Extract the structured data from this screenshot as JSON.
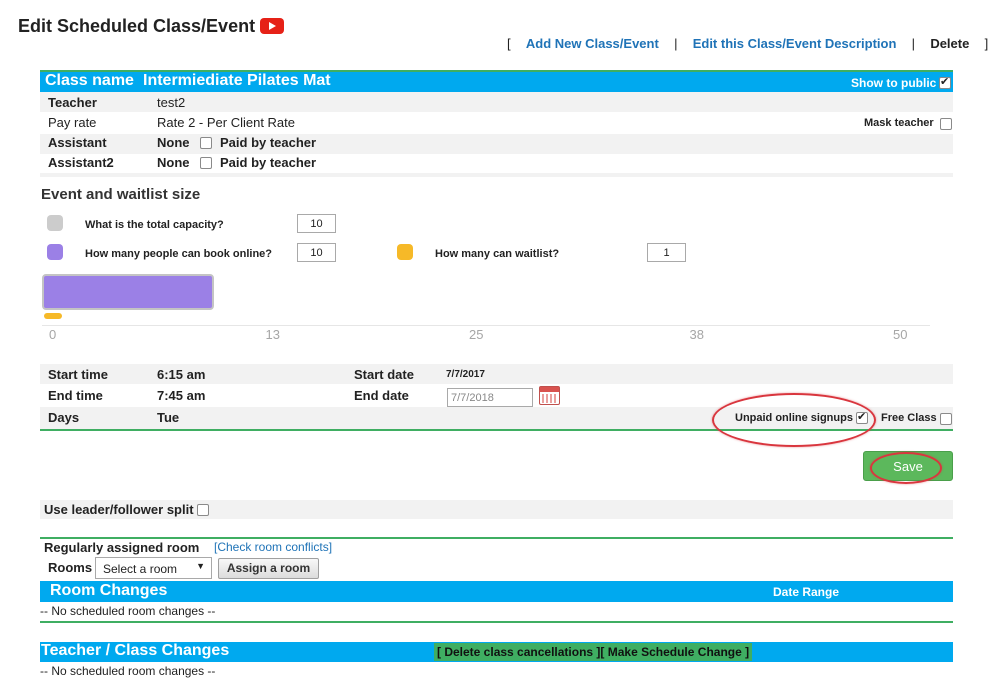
{
  "header": {
    "title": "Edit Scheduled Class/Event",
    "links": {
      "open_bracket": "[",
      "add_new": "Add New Class/Event",
      "sep1": "|",
      "edit_desc": "Edit this Class/Event Description",
      "sep2": "|",
      "delete": "Delete",
      "close_bracket": "]"
    }
  },
  "class_info": {
    "name_label": "Class name",
    "name_value": "Intermiediate Pilates Mat",
    "show_public_label": "Show to public",
    "show_public_checked": true,
    "teacher_label": "Teacher",
    "teacher_value": "test2",
    "pay_rate_label": "Pay rate",
    "pay_rate_value": "Rate 2 - Per Client Rate",
    "mask_teacher_label": "Mask teacher",
    "assistant_label": "Assistant",
    "assistant_value": "None",
    "assistant_paid_label": "Paid by teacher",
    "assistant2_label": "Assistant2",
    "assistant2_value": "None",
    "assistant2_paid_label": "Paid by teacher"
  },
  "capacity": {
    "section_title": "Event and waitlist size",
    "total_label": "What is the total capacity?",
    "total_value": "10",
    "online_label": "How many people can book online?",
    "online_value": "10",
    "waitlist_label": "How many can waitlist?",
    "waitlist_value": "1",
    "colors": {
      "total": "#cccccc",
      "online": "#9b80e6",
      "waitlist": "#f6b928"
    },
    "bar": {
      "axis_max": 50,
      "online_value": 10,
      "waitlist_value": 1,
      "ticks": [
        "0",
        "13",
        "25",
        "38",
        "50"
      ]
    }
  },
  "schedule": {
    "start_time_label": "Start time",
    "start_time_value": "6:15 am",
    "end_time_label": "End time",
    "end_time_value": "7:45 am",
    "start_date_label": "Start date",
    "start_date_value": "7/7/2017",
    "end_date_label": "End date",
    "end_date_value": "7/7/2018",
    "days_label": "Days",
    "days_value": "Tue",
    "unpaid_label": "Unpaid online signups",
    "unpaid_checked": true,
    "free_class_label": "Free Class"
  },
  "actions": {
    "save_label": "Save"
  },
  "leader": {
    "label": "Use leader/follower split"
  },
  "rooms": {
    "assigned_label": "Regularly assigned room",
    "check_conflicts": "[Check room conflicts]",
    "rooms_label": "Rooms",
    "select_value": "Select a room",
    "assign_button": "Assign a room"
  },
  "room_changes": {
    "title": "Room Changes",
    "date_range": "Date Range",
    "empty": "-- No scheduled room changes --"
  },
  "teacher_changes": {
    "title": "Teacher / Class Changes",
    "actions_text": "[ Delete class cancellations ][ Make Schedule Change ]",
    "empty": "-- No scheduled room changes --"
  }
}
